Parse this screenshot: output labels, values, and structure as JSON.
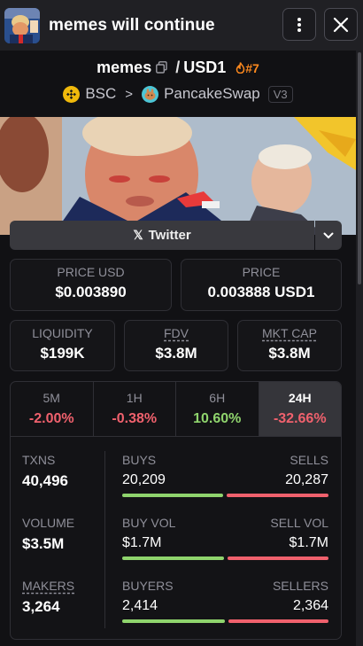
{
  "header": {
    "title": "memes will continue"
  },
  "pair": {
    "base": "memes",
    "separator": "/",
    "quote": "USD1",
    "rank": "#7"
  },
  "network": {
    "chain": "BSC",
    "dex": "PancakeSwap",
    "version": "V3"
  },
  "social": {
    "twitter_label": "Twitter"
  },
  "prices": {
    "usd_label": "PRICE USD",
    "usd_value": "$0.003890",
    "native_label": "PRICE",
    "native_value": "0.003888 USD1"
  },
  "metrics": {
    "liquidity_label": "LIQUIDITY",
    "liquidity_value": "$199K",
    "fdv_label": "FDV",
    "fdv_value": "$3.8M",
    "mcap_label": "MKT CAP",
    "mcap_value": "$3.8M"
  },
  "timeframes": [
    {
      "label": "5M",
      "change": "-2.00%"
    },
    {
      "label": "1H",
      "change": "-0.38%"
    },
    {
      "label": "6H",
      "change": "10.60%"
    },
    {
      "label": "24H",
      "change": "-32.66%"
    }
  ],
  "stats": {
    "txns_label": "TXNS",
    "txns_value": "40,496",
    "volume_label": "VOLUME",
    "volume_value": "$3.5M",
    "makers_label": "MAKERS",
    "makers_value": "3,264",
    "buys_label": "BUYS",
    "buys_value": "20,209",
    "sells_label": "SELLS",
    "sells_value": "20,287",
    "buys_fraction": 0.499,
    "buyvol_label": "BUY VOL",
    "buyvol_value": "$1.7M",
    "sellvol_label": "SELL VOL",
    "sellvol_value": "$1.7M",
    "buyvol_fraction": 0.5,
    "buyers_label": "BUYERS",
    "buyers_value": "2,414",
    "sellers_label": "SELLERS",
    "sellers_value": "2,364",
    "buyers_fraction": 0.505
  },
  "colors": {
    "positive": "#8fd46d",
    "negative": "#f0616d",
    "rank": "#ff8a1e",
    "bsc": "#f0b90b",
    "pancake": "#4dc6d6"
  },
  "icons": [
    "avatar-image",
    "more-vertical-icon",
    "close-icon",
    "copy-icon",
    "flame-icon",
    "bsc-icon",
    "chevron-right-icon",
    "pancakeswap-icon",
    "x-logo-icon",
    "chevron-down-icon"
  ]
}
